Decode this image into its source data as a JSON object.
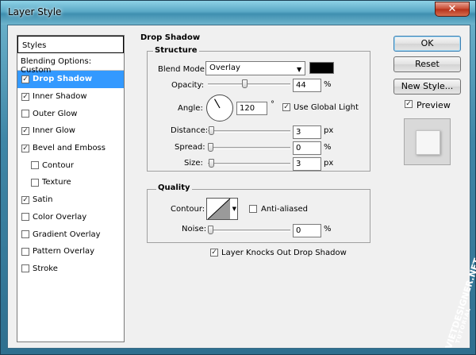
{
  "window": {
    "title": "Layer Style",
    "close_glyph": "✕"
  },
  "styles": {
    "header": "Styles",
    "blending_options": "Blending Options: Custom",
    "items": [
      {
        "label": "Drop Shadow",
        "checked": true,
        "selected": true,
        "sub": false
      },
      {
        "label": "Inner Shadow",
        "checked": true,
        "selected": false,
        "sub": false
      },
      {
        "label": "Outer Glow",
        "checked": false,
        "selected": false,
        "sub": false
      },
      {
        "label": "Inner Glow",
        "checked": true,
        "selected": false,
        "sub": false
      },
      {
        "label": "Bevel and Emboss",
        "checked": true,
        "selected": false,
        "sub": false
      },
      {
        "label": "Contour",
        "checked": false,
        "selected": false,
        "sub": true
      },
      {
        "label": "Texture",
        "checked": false,
        "selected": false,
        "sub": true
      },
      {
        "label": "Satin",
        "checked": true,
        "selected": false,
        "sub": false
      },
      {
        "label": "Color Overlay",
        "checked": false,
        "selected": false,
        "sub": false
      },
      {
        "label": "Gradient Overlay",
        "checked": false,
        "selected": false,
        "sub": false
      },
      {
        "label": "Pattern Overlay",
        "checked": false,
        "selected": false,
        "sub": false
      },
      {
        "label": "Stroke",
        "checked": false,
        "selected": false,
        "sub": false
      }
    ]
  },
  "drop_shadow": {
    "title": "Drop Shadow",
    "structure": {
      "title": "Structure",
      "blend_mode_label": "Blend Mode:",
      "blend_mode_value": "Overlay",
      "shadow_color": "#000000",
      "opacity_label": "Opacity:",
      "opacity_value": "44",
      "opacity_unit": "%",
      "opacity_fraction": 0.44,
      "angle_label": "Angle:",
      "angle_value": "120",
      "angle_unit": "°",
      "angle_degrees": 120,
      "use_global_light_label": "Use Global Light",
      "use_global_light": true,
      "distance_label": "Distance:",
      "distance_value": "3",
      "distance_unit": "px",
      "spread_label": "Spread:",
      "spread_value": "0",
      "spread_unit": "%",
      "size_label": "Size:",
      "size_value": "3",
      "size_unit": "px"
    },
    "quality": {
      "title": "Quality",
      "contour_label": "Contour:",
      "anti_aliased_label": "Anti-aliased",
      "anti_aliased": false,
      "noise_label": "Noise:",
      "noise_value": "0",
      "noise_unit": "%"
    },
    "knocks_out_label": "Layer Knocks Out Drop Shadow",
    "knocks_out": true
  },
  "buttons": {
    "ok": "OK",
    "reset": "Reset",
    "new_style": "New Style...",
    "preview_label": "Preview",
    "preview_checked": true
  },
  "watermark": {
    "line1": "VIETDESIGNER.NET",
    "line2": "TUTORIAL"
  }
}
